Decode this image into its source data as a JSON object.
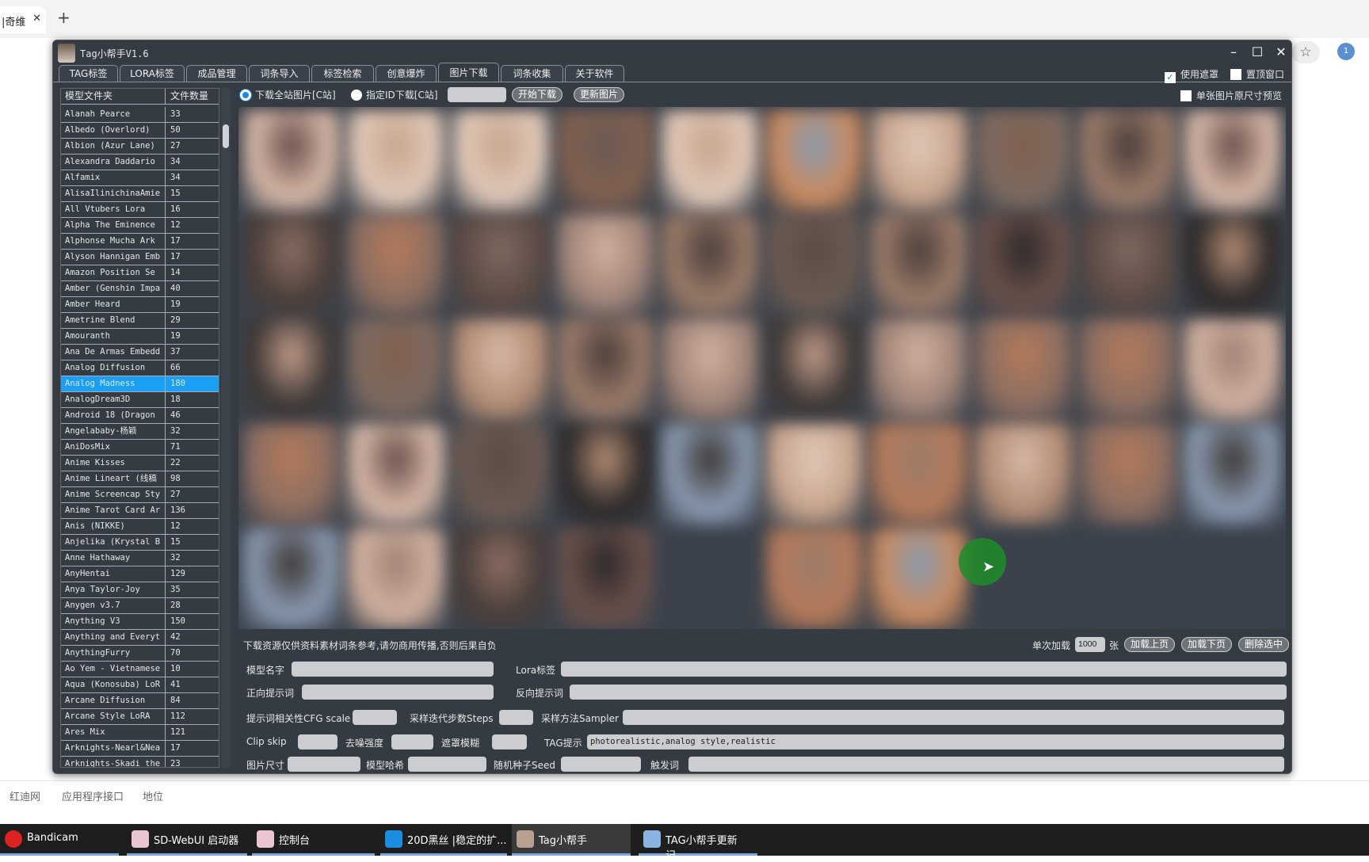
{
  "browser": {
    "tab_title": "|奇维",
    "bottom_links": [
      "红迪网",
      "应用程序接口",
      "地位"
    ]
  },
  "taskbar": [
    {
      "label": "Bandicam",
      "color": "#d22"
    },
    {
      "label": "SD-WebUI 启动器",
      "color": "#e9c6d2"
    },
    {
      "label": "控制台",
      "color": "#e9c6d2"
    },
    {
      "label": "20D黑丝 |稳定的扩...",
      "color": "#1a8de0"
    },
    {
      "label": "Tag小帮手",
      "color": "#b8a090",
      "active": true
    },
    {
      "label": "TAG小帮手更新记...",
      "color": "#8ab4e0"
    }
  ],
  "window": {
    "title": "Tag小帮手V1.6",
    "minimize": "–",
    "maximize": "☐",
    "close": "✕"
  },
  "tabs": [
    "TAG标签",
    "LORA标签",
    "成品管理",
    "词条导入",
    "标签检索",
    "创意爆炸",
    "图片下载",
    "词条收集",
    "关于软件"
  ],
  "active_tab": 6,
  "options": {
    "use_mask": {
      "label": "使用遮罩",
      "checked": true
    },
    "pin_window": {
      "label": "置顶窗口",
      "checked": false
    },
    "single_preview": {
      "label": "单张图片原尺寸预览",
      "checked": false
    }
  },
  "download": {
    "radio_all": {
      "label": "下载全站图片[C站]",
      "selected": true
    },
    "radio_id": {
      "label": "指定ID下载[C站]",
      "selected": false
    },
    "id_value": "",
    "start": "开始下载",
    "refresh": "更新图片"
  },
  "list": {
    "headers": [
      "模型文件夹",
      "文件数量"
    ],
    "selected": "Analog Madness",
    "rows": [
      [
        "Alanah Pearce",
        "33"
      ],
      [
        "Albedo (Overlord)",
        "50"
      ],
      [
        "Albion (Azur Lane)",
        "27"
      ],
      [
        "Alexandra Daddario",
        "34"
      ],
      [
        "Alfamix",
        "34"
      ],
      [
        "AlisaIlinichinaAmie",
        "15"
      ],
      [
        "All Vtubers Lora",
        "16"
      ],
      [
        "Alpha  The Eminence",
        "12"
      ],
      [
        "Alphonse  Mucha Ark",
        "17"
      ],
      [
        "Alyson Hannigan Emb",
        "17"
      ],
      [
        "Amazon Position  Se",
        "14"
      ],
      [
        "Amber (Genshin Impa",
        "40"
      ],
      [
        "Amber Heard",
        "19"
      ],
      [
        "Ametrine Blend",
        "29"
      ],
      [
        "Amouranth",
        "19"
      ],
      [
        "Ana De Armas Embedd",
        "37"
      ],
      [
        "Analog Diffusion",
        "66"
      ],
      [
        "Analog Madness",
        "180"
      ],
      [
        "AnalogDream3D",
        "18"
      ],
      [
        "Android 18 (Dragon",
        "46"
      ],
      [
        "Angelababy-杨颖",
        "32"
      ],
      [
        "AniDosMix",
        "71"
      ],
      [
        "Anime Kisses",
        "22"
      ],
      [
        "Anime Lineart (线稿",
        "98"
      ],
      [
        "Anime Screencap Sty",
        "27"
      ],
      [
        "Anime Tarot Card Ar",
        "136"
      ],
      [
        "Anis (NIKKE)",
        "12"
      ],
      [
        "Anjelika (Krystal B",
        "15"
      ],
      [
        "Anne Hathaway",
        "32"
      ],
      [
        "AnyHentai",
        "129"
      ],
      [
        "Anya Taylor-Joy",
        "35"
      ],
      [
        "Anygen v3.7",
        "28"
      ],
      [
        "Anything V3",
        "150"
      ],
      [
        "Anything and Everyt",
        "42"
      ],
      [
        "AnythingFurry",
        "70"
      ],
      [
        "Ao Yem - Vietnamese",
        "10"
      ],
      [
        "Aqua (Konosuba) LoR",
        "41"
      ],
      [
        "Arcane Diffusion",
        "84"
      ],
      [
        "Arcane Style LoRA",
        "112"
      ],
      [
        "Ares Mix",
        "121"
      ],
      [
        "Arknights-Nearl&Nea",
        "17"
      ],
      [
        "Arknights-Skadi the",
        "23"
      ]
    ]
  },
  "status": {
    "notice": "下载资源仅供资料素材词条参考,请勿商用传播,否则后果自负",
    "load_label": "单次加载",
    "load_count": "1000",
    "unit": "张",
    "prev": "加载上页",
    "next": "加载下页",
    "delete": "删除选中"
  },
  "form": {
    "model_name": {
      "label": "模型名字",
      "value": ""
    },
    "lora_tag": {
      "label": "Lora标签",
      "value": ""
    },
    "positive": {
      "label": "正向提示词",
      "value": ""
    },
    "negative": {
      "label": "反向提示词",
      "value": ""
    },
    "cfg": {
      "label": "提示词相关性CFG scale",
      "value": ""
    },
    "steps": {
      "label": "采样迭代步数Steps",
      "value": ""
    },
    "sampler": {
      "label": "采样方法Sampler",
      "value": ""
    },
    "clip_skip": {
      "label": "Clip skip",
      "value": ""
    },
    "denoise": {
      "label": "去噪强度",
      "value": ""
    },
    "mask_blur": {
      "label": "遮罩模糊",
      "value": ""
    },
    "tag_hint": {
      "label": "TAG提示",
      "value": "photorealistic,analog style,realistic"
    },
    "size": {
      "label": "图片尺寸",
      "value": ""
    },
    "model_hash": {
      "label": "模型哈希",
      "value": ""
    },
    "seed": {
      "label": "随机种子Seed",
      "value": ""
    },
    "trigger": {
      "label": "触发词",
      "value": ""
    }
  },
  "colors": {
    "window_bg": "#353b43",
    "selected_row": "#19a0f5",
    "input_bg": "#cbcdd0"
  }
}
